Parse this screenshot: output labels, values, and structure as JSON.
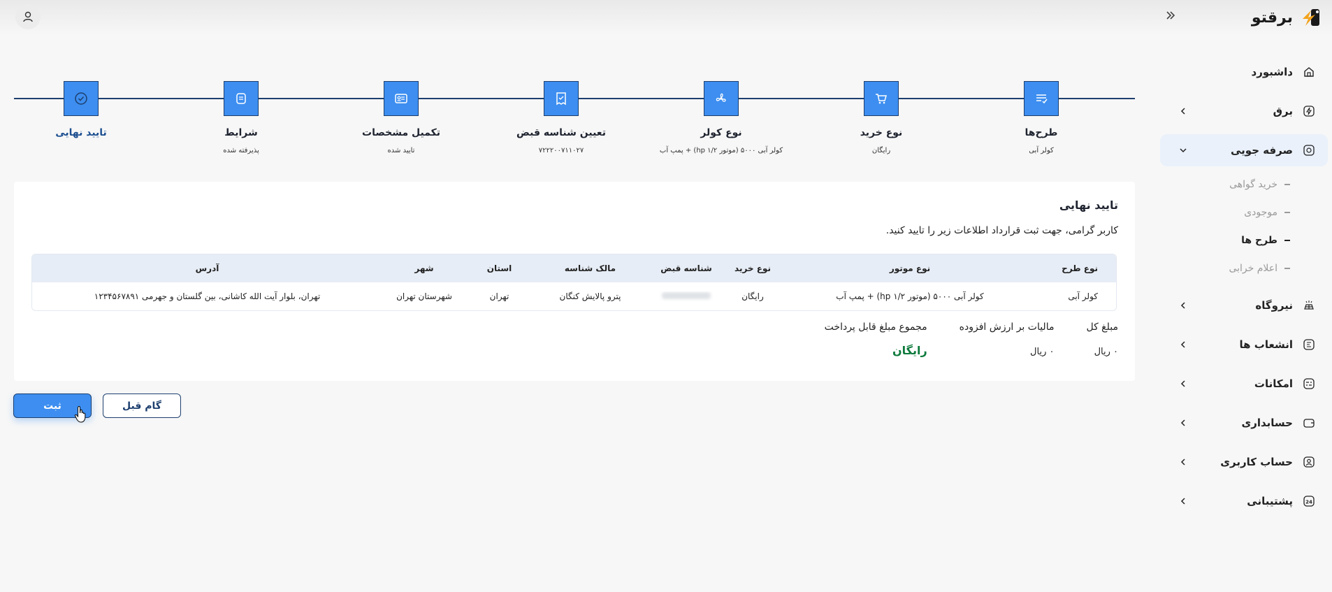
{
  "brand": {
    "name": "برقتو"
  },
  "sidebar": {
    "items": [
      {
        "label": "داشبورد",
        "icon": "home-icon",
        "has_children": false
      },
      {
        "label": "برق",
        "icon": "plug-icon",
        "has_children": true
      },
      {
        "label": "صرفه جویی",
        "icon": "savings-icon",
        "has_children": true,
        "expanded": true,
        "children": [
          {
            "label": "خرید گواهی",
            "active": false
          },
          {
            "label": "موجودی",
            "active": false
          },
          {
            "label": "طرح ها",
            "active": true
          },
          {
            "label": "اعلام خرابی",
            "active": false
          }
        ]
      },
      {
        "label": "نیروگاه",
        "icon": "solar-panel-icon",
        "has_children": true
      },
      {
        "label": "انشعاب ها",
        "icon": "branch-icon",
        "has_children": true
      },
      {
        "label": "امکانات",
        "icon": "tools-icon",
        "has_children": true
      },
      {
        "label": "حسابداری",
        "icon": "wallet-icon",
        "has_children": true
      },
      {
        "label": "حساب کاربری",
        "icon": "user-circle-icon",
        "has_children": true
      },
      {
        "label": "پشتیبانی",
        "icon": "support-24-icon",
        "has_children": true
      }
    ]
  },
  "stepper": {
    "steps": [
      {
        "title": "طرح‌ها",
        "subtitle": "کولر آبی",
        "icon": "list-check-icon"
      },
      {
        "title": "نوع خرید",
        "subtitle": "رایگان",
        "icon": "cart-icon"
      },
      {
        "title": "نوع کولر",
        "subtitle": "کولر آبی ۵۰۰۰ (موتور hp ۱/۲) + پمپ آب",
        "icon": "fan-icon"
      },
      {
        "title": "تعیین شناسه قبض",
        "subtitle": "۷۲۲۲۰۰۷۱۱۰۲۷",
        "icon": "receipt-icon"
      },
      {
        "title": "تکمیل مشخصات",
        "subtitle": "تایید شده",
        "icon": "id-card-icon"
      },
      {
        "title": "شرایط",
        "subtitle": "پذیرفته شده",
        "icon": "document-icon"
      },
      {
        "title": "تایید نهایی",
        "subtitle": "",
        "icon": "check-circle-icon",
        "current": true
      }
    ]
  },
  "card": {
    "title": "تایید نهایی",
    "description": "کاربر گرامی، جهت ثبت قرارداد اطلاعات زیر را تایید کنید.",
    "table": {
      "headers": [
        "نوع طرح",
        "نوع موتور",
        "نوع خرید",
        "شناسه قبض",
        "مالک شناسه",
        "استان",
        "شهر",
        "آدرس"
      ],
      "row": [
        "کولر آبی",
        "کولر آبی ۵۰۰۰ (موتور hp ۱/۲) + پمپ آب",
        "رایگان",
        "",
        "پترو پالایش کنگان",
        "تهران",
        "شهرستان تهران",
        "تهران، بلوار آیت الله کاشانی، بین گلستان و جهرمی ۱۲۳۴۵۶۷۸۹۱"
      ]
    },
    "totals": {
      "total_label": "مبلغ کل",
      "total_value": "۰ ریال",
      "tax_label": "مالیات بر ارزش افزوده",
      "tax_value": "۰ ریال",
      "payable_label": "مجموع مبلغ قابل پرداخت",
      "payable_value": "رایگان"
    }
  },
  "actions": {
    "submit_label": "ثبت",
    "back_label": "گام قبل"
  },
  "colors": {
    "accent": "#3d8ef0",
    "navy": "#1d3f6e",
    "success": "#0d7a3c"
  }
}
